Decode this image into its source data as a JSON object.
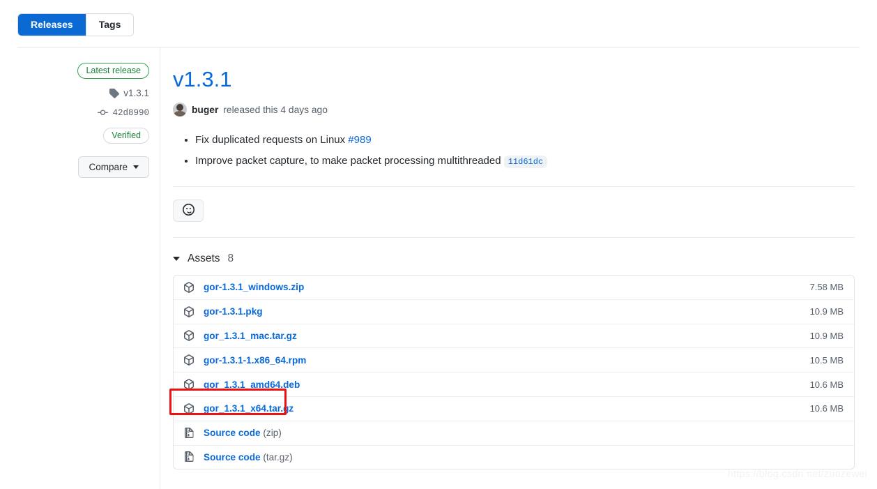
{
  "tabs": [
    {
      "label": "Releases",
      "active": true
    },
    {
      "label": "Tags",
      "active": false
    }
  ],
  "sidebar": {
    "latest_badge": "Latest release",
    "tag_name": "v1.3.1",
    "tag_icon": "tag-icon",
    "commit_sha": "42d8990",
    "commit_icon": "commit-icon",
    "verified_badge": "Verified",
    "compare_button": "Compare"
  },
  "release": {
    "title": "v1.3.1",
    "author": "buger",
    "byline_rest": "released this 4 days ago",
    "notes": [
      {
        "text": "Fix duplicated requests on Linux ",
        "link": "#989",
        "chip": ""
      },
      {
        "text": "Improve packet capture, to make packet processing multithreaded ",
        "link": "",
        "chip": "11d61dc"
      }
    ],
    "reaction_icon": "smiley-icon"
  },
  "assets": {
    "heading_label": "Assets",
    "heading_count": "8",
    "rows": [
      {
        "name": "gor-1.3.1_windows.zip",
        "suffix": "",
        "size": "7.58 MB",
        "icon": "package-icon",
        "highlighted": false
      },
      {
        "name": "gor-1.3.1.pkg",
        "suffix": "",
        "size": "10.9 MB",
        "icon": "package-icon",
        "highlighted": false
      },
      {
        "name": "gor_1.3.1_mac.tar.gz",
        "suffix": "",
        "size": "10.9 MB",
        "icon": "package-icon",
        "highlighted": false
      },
      {
        "name": "gor-1.3.1-1.x86_64.rpm",
        "suffix": "",
        "size": "10.5 MB",
        "icon": "package-icon",
        "highlighted": false
      },
      {
        "name": "gor_1.3.1_amd64.deb",
        "suffix": "",
        "size": "10.6 MB",
        "icon": "package-icon",
        "highlighted": false
      },
      {
        "name": "gor_1.3.1_x64.tar.gz",
        "suffix": "",
        "size": "10.6 MB",
        "icon": "package-icon",
        "highlighted": true
      },
      {
        "name": "Source code",
        "suffix": " (zip)",
        "size": "",
        "icon": "file-zip-icon",
        "highlighted": false
      },
      {
        "name": "Source code",
        "suffix": " (tar.gz)",
        "size": "",
        "icon": "file-zip-icon",
        "highlighted": false
      }
    ]
  },
  "watermark": "https://blog.csdn.net/zuozewei",
  "colors": {
    "accent_blue": "#0969da",
    "tab_active": "#0b69d4",
    "green": "#1a7f37",
    "highlight_red": "#ee1111",
    "muted": "#57606a"
  }
}
